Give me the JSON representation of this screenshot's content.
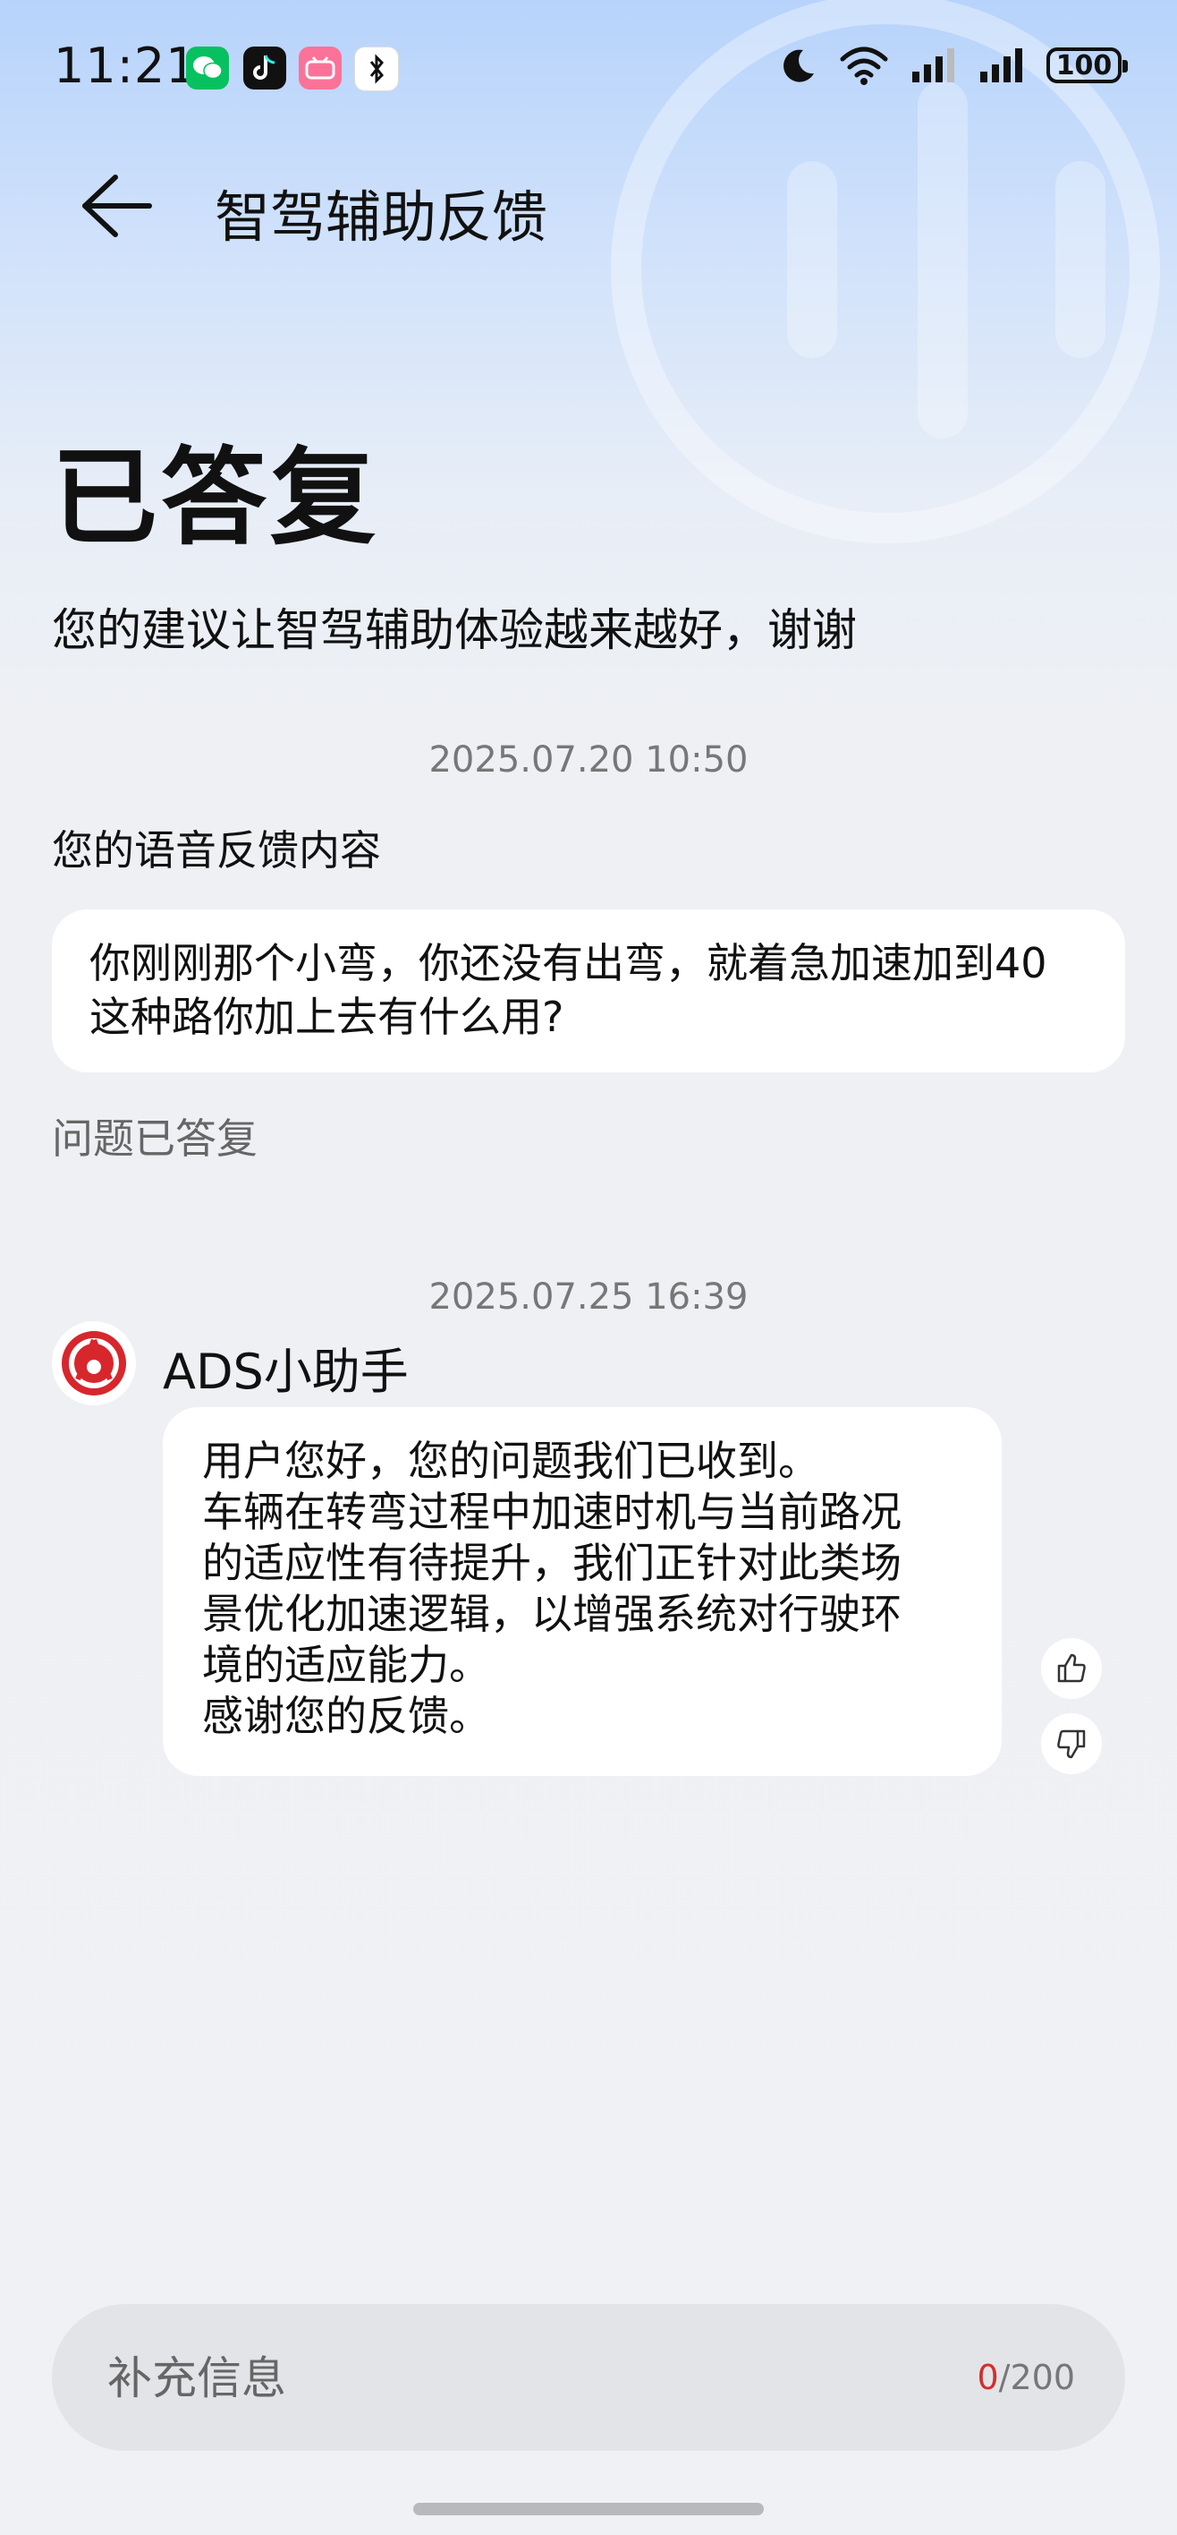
{
  "status_bar": {
    "time": "11:21",
    "apps": [
      {
        "name": "wechat-icon",
        "color": "#07c160"
      },
      {
        "name": "tiktok-icon",
        "color": "#111111"
      },
      {
        "name": "bilibili-icon",
        "color": "#fb7299"
      },
      {
        "name": "bluetooth-style-icon",
        "color": "#ffffff"
      }
    ],
    "battery": "100"
  },
  "header": {
    "title": "智驾辅助反馈"
  },
  "status": {
    "heading": "已答复",
    "subtitle": "您的建议让智驾辅助体验越来越好，谢谢"
  },
  "user_feedback": {
    "timestamp": "2025.07.20 10:50",
    "label": "您的语音反馈内容",
    "content": "你刚刚那个小弯，你还没有出弯，就着急加速加到40这种路你加上去有什么用?",
    "state": "问题已答复"
  },
  "reply": {
    "timestamp": "2025.07.25 16:39",
    "sender": "ADS小助手",
    "lines": [
      "用户您好，您的问题我们已收到。",
      "车辆在转弯过程中加速时机与当前路况",
      "的适应性有待提升，我们正针对此类场",
      "景优化加速逻辑，以增强系统对行驶环",
      "境的适应能力。",
      "感谢您的反馈。"
    ],
    "avatar_color": "#d8262d"
  },
  "input": {
    "placeholder": "补充信息",
    "count": "0",
    "max": "/200"
  }
}
